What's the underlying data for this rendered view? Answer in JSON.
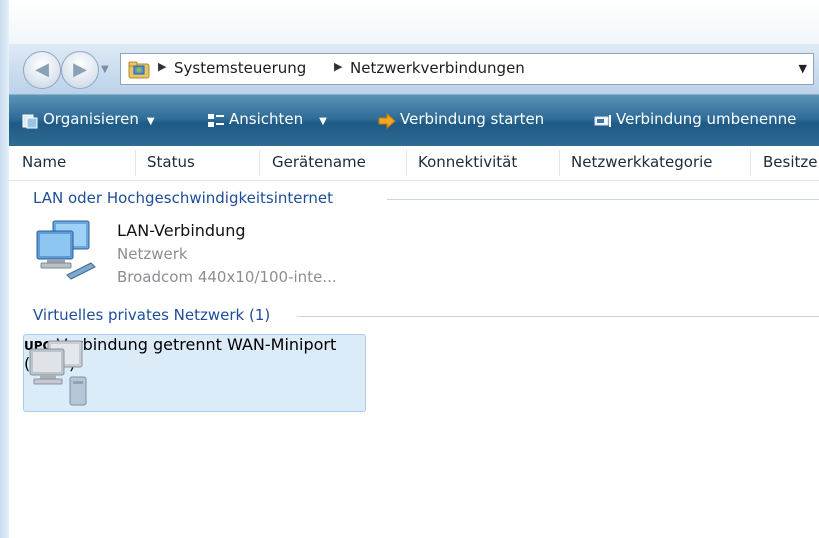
{
  "breadcrumb": [
    "Systemsteuerung",
    "Netzwerkverbindungen"
  ],
  "toolbar": {
    "organize": "Organisieren",
    "views": "Ansichten",
    "start_connection": "Verbindung starten",
    "rename_connection": "Verbindung umbenenne"
  },
  "columns": [
    "Name",
    "Status",
    "Gerätename",
    "Konnektivität",
    "Netzwerkkategorie",
    "Besitze"
  ],
  "groups": [
    {
      "title": "LAN oder Hochgeschwindigkeitsinternet",
      "items": [
        {
          "name": "LAN-Verbindung",
          "status": "Netzwerk",
          "device": "Broadcom 440x10/100-inte..."
        }
      ]
    },
    {
      "title": "Virtuelles privates Netzwerk (1)",
      "items": [
        {
          "name": "UPC",
          "status": "Verbindung getrennt",
          "device": "WAN-Miniport (PPTP)"
        }
      ]
    }
  ],
  "icons": {
    "back": "back-arrow-icon",
    "forward": "forward-arrow-icon",
    "folder": "network-folder-icon",
    "organize": "organize-icon",
    "views": "views-icon",
    "start": "start-connection-arrow-icon",
    "rename": "rename-icon",
    "lan": "lan-computers-icon",
    "vpn": "vpn-computer-icon"
  },
  "colors": {
    "toolbar": "#2f6c97",
    "group_title": "#1e4d99",
    "selection": "#dcebf8"
  }
}
